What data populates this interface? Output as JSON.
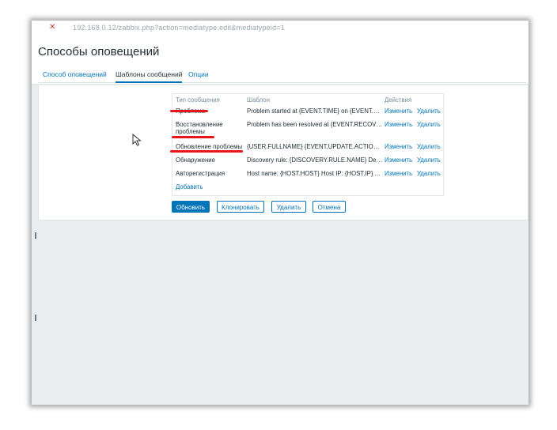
{
  "browser": {
    "url": "192.168.0.12/zabbix.php?action=mediatype.edit&mediatypeid=1"
  },
  "page": {
    "title": "Способы оповещений"
  },
  "tabs": [
    {
      "label": "Способ оповещений",
      "active": false
    },
    {
      "label": "Шаблоны сообщений",
      "active": true
    },
    {
      "label": "Опции",
      "active": false
    }
  ],
  "table": {
    "headers": {
      "type": "Тип сообщения",
      "template": "Шаблон",
      "actions": "Действия"
    },
    "rows": [
      {
        "type": "Проблема",
        "template": "Problem started at {EVENT.TIME} on {EVENT.DATE}",
        "edit": "Изменить",
        "delete": "Удалить",
        "highlighted": true
      },
      {
        "type_line1": "Восстановление",
        "type_line2": "проблемы",
        "template": "Problem has been resolved at {EVENT.RECOVERY.TIME}",
        "edit": "Изменить",
        "delete": "Удалить",
        "highlighted": true
      },
      {
        "type": "Обновление проблемы",
        "template": "{USER.FULLNAME} {EVENT.UPDATE.ACTION} problem",
        "edit": "Изменить",
        "delete": "Удалить",
        "highlighted": true
      },
      {
        "type": "Обнаружение",
        "template": "Discovery rule: {DISCOVERY.RULE.NAME} Device",
        "edit": "Изменить",
        "delete": "Удалить",
        "highlighted": false
      },
      {
        "type": "Авторегистрация",
        "template": "Host name: {HOST.HOST} Host IP: {HOST.IP} Agent",
        "edit": "Изменить",
        "delete": "Удалить",
        "highlighted": false
      }
    ],
    "add_label": "Добавить"
  },
  "buttons": {
    "update": "Обновить",
    "clone": "Клонировать",
    "delete": "Удалить",
    "cancel": "Отмена"
  },
  "colors": {
    "link": "#0275b8",
    "annotation": "#e8141c",
    "text": "#1f2c33",
    "muted": "#768d99"
  }
}
